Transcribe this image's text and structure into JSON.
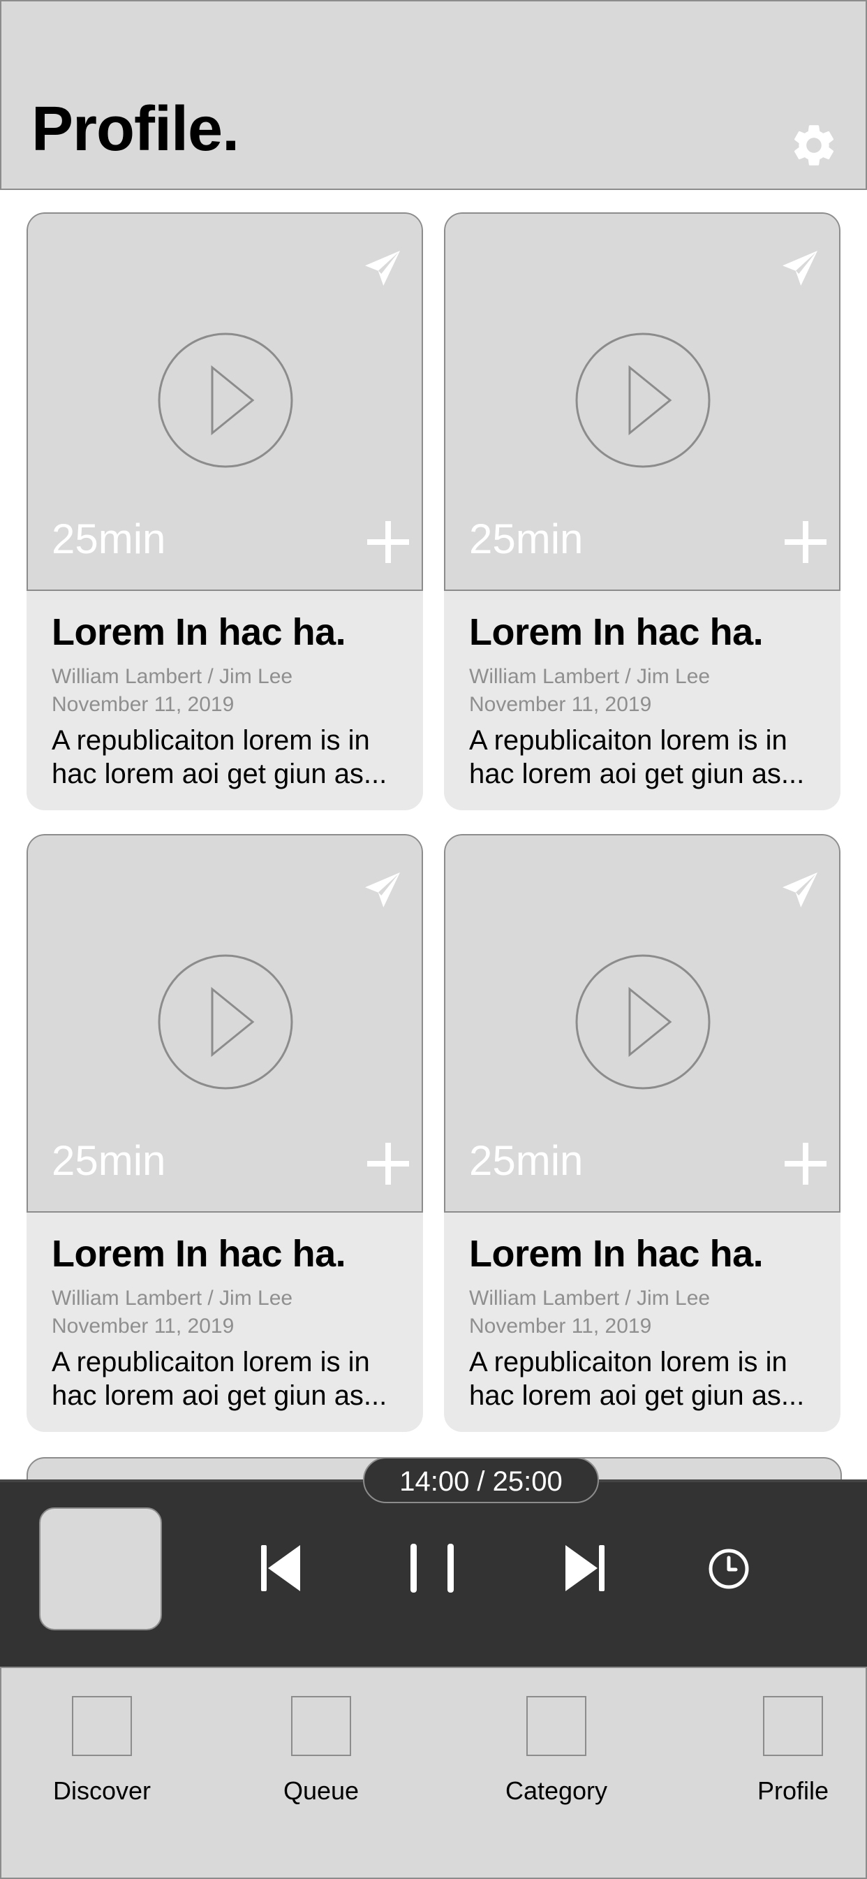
{
  "header": {
    "title": "Profile."
  },
  "cards": [
    {
      "duration": "25min",
      "title": "Lorem In hac ha.",
      "authors": "William Lambert / Jim Lee",
      "date": "November 11, 2019",
      "desc_line1": "A republicaiton lorem is in",
      "desc_line2": "hac lorem aoi get giun as..."
    },
    {
      "duration": "25min",
      "title": "Lorem In hac ha.",
      "authors": "William Lambert / Jim Lee",
      "date": "November 11, 2019",
      "desc_line1": "A republicaiton lorem is in",
      "desc_line2": "hac lorem aoi get giun as..."
    },
    {
      "duration": "25min",
      "title": "Lorem In hac ha.",
      "authors": "William Lambert / Jim Lee",
      "date": "November 11, 2019",
      "desc_line1": "A republicaiton lorem is in",
      "desc_line2": "hac lorem aoi get giun as..."
    },
    {
      "duration": "25min",
      "title": "Lorem In hac ha.",
      "authors": "William Lambert / Jim Lee",
      "date": "November 11, 2019",
      "desc_line1": "A republicaiton lorem is in",
      "desc_line2": "hac lorem aoi get giun as..."
    }
  ],
  "player": {
    "time": "14:00 / 25:00",
    "controls": [
      "skip-previous-icon",
      "pause-icon",
      "skip-next-icon",
      "clock-icon"
    ]
  },
  "nav": {
    "items": [
      {
        "label": "Discover"
      },
      {
        "label": "Queue"
      },
      {
        "label": "Category"
      },
      {
        "label": "Profile"
      }
    ]
  },
  "colors": {
    "header_bg": "#d9d9d9",
    "card_bg": "#e9e9e9",
    "thumb_bg": "#d9d9d9",
    "player_bg": "#333333",
    "border": "#8c8c8c",
    "meta_text": "#8f8f8f"
  }
}
